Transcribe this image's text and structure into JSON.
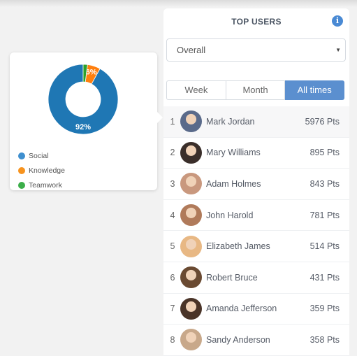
{
  "panel": {
    "title": "TOP USERS",
    "info_icon": "info-circle-icon",
    "filter": {
      "selected": "Overall",
      "arrow_icon": "caret-down-icon"
    },
    "tabs": [
      {
        "label": "Week",
        "active": false
      },
      {
        "label": "Month",
        "active": false
      },
      {
        "label": "All times",
        "active": true
      }
    ],
    "users": [
      {
        "rank": "1",
        "name": "Mark Jordan",
        "points": "5976 Pts",
        "avatar_color": "#5a6a8a"
      },
      {
        "rank": "2",
        "name": "Mary Williams",
        "points": "895 Pts",
        "avatar_color": "#3a2e2a"
      },
      {
        "rank": "3",
        "name": "Adam Holmes",
        "points": "843 Pts",
        "avatar_color": "#c9987e"
      },
      {
        "rank": "4",
        "name": "John Harold",
        "points": "781 Pts",
        "avatar_color": "#b07a5a"
      },
      {
        "rank": "5",
        "name": "Elizabeth James",
        "points": "514 Pts",
        "avatar_color": "#e8b884"
      },
      {
        "rank": "6",
        "name": "Robert Bruce",
        "points": "431 Pts",
        "avatar_color": "#6a4a32"
      },
      {
        "rank": "7",
        "name": "Amanda Jefferson",
        "points": "359 Pts",
        "avatar_color": "#4a3428"
      },
      {
        "rank": "8",
        "name": "Sandy Anderson",
        "points": "358 Pts",
        "avatar_color": "#c8a88a"
      }
    ]
  },
  "chart_data": {
    "type": "pie",
    "donut": true,
    "categories": [
      "Social",
      "Knowledge",
      "Teamwork"
    ],
    "values": [
      92,
      6,
      2
    ],
    "colors": [
      "#1f77b4",
      "#ff7f0e",
      "#2ca02c"
    ],
    "data_labels": [
      "92%",
      "6%",
      ""
    ],
    "legend": "bottom-left"
  }
}
